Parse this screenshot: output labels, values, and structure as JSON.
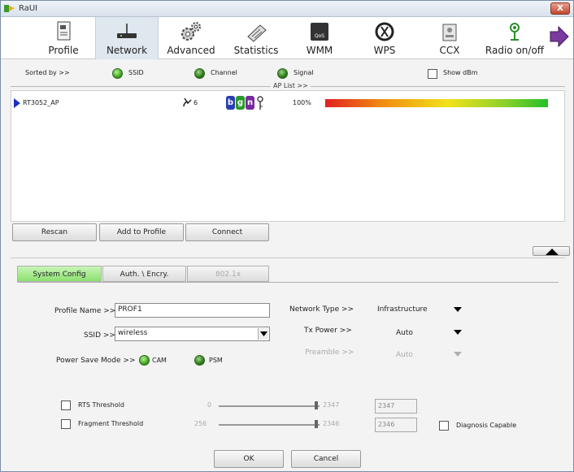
{
  "window": {
    "title": "RaUI",
    "close_label": "X"
  },
  "toolbar": {
    "items": [
      {
        "label": "Profile",
        "icon": "profile-icon"
      },
      {
        "label": "Network",
        "icon": "network-icon",
        "active": true
      },
      {
        "label": "Advanced",
        "icon": "gears-icon"
      },
      {
        "label": "Statistics",
        "icon": "statistics-icon"
      },
      {
        "label": "WMM",
        "icon": "wmm-icon"
      },
      {
        "label": "WPS",
        "icon": "wps-icon"
      },
      {
        "label": "CCX",
        "icon": "ccx-icon"
      },
      {
        "label": "Radio on/off",
        "icon": "radio-antenna-icon"
      }
    ],
    "more_icon": "arrow-right-icon"
  },
  "sort": {
    "label": "Sorted by >>",
    "options": [
      "SSID",
      "Channel",
      "Signal"
    ],
    "show_dbm": "Show dBm"
  },
  "ap_list": {
    "label": "AP List >>",
    "rows": [
      {
        "ssid": "RT3052_AP",
        "channel": "6",
        "modes": [
          "b",
          "g",
          "n"
        ],
        "signal": "100%"
      }
    ]
  },
  "buttons": {
    "rescan": "Rescan",
    "add_to_profile": "Add to Profile",
    "connect": "Connect"
  },
  "tabs": {
    "system_config": "System Config",
    "auth_encry": "Auth. \\ Encry.",
    "dot1x": "802.1x"
  },
  "form": {
    "profile_name_label": "Profile Name >>",
    "profile_name_value": "PROF1",
    "ssid_label": "SSID >>",
    "ssid_value": "wireless",
    "power_save_label": "Power Save Mode >>",
    "power_save_cam": "CAM",
    "power_save_psm": "PSM",
    "network_type_label": "Network Type >>",
    "network_type_value": "Infrastructure",
    "tx_power_label": "Tx Power >>",
    "tx_power_value": "Auto",
    "preamble_label": "Preamble >>",
    "preamble_value": "Auto",
    "rts_label": "RTS Threshold",
    "rts_min": "0",
    "rts_max": "2347",
    "rts_value": "2347",
    "frag_label": "Fragment Threshold",
    "frag_min": "256",
    "frag_max": "2346",
    "frag_value": "2346",
    "diagnosis_label": "Diagnosis Capable"
  },
  "footer": {
    "ok": "OK",
    "cancel": "Cancel"
  }
}
